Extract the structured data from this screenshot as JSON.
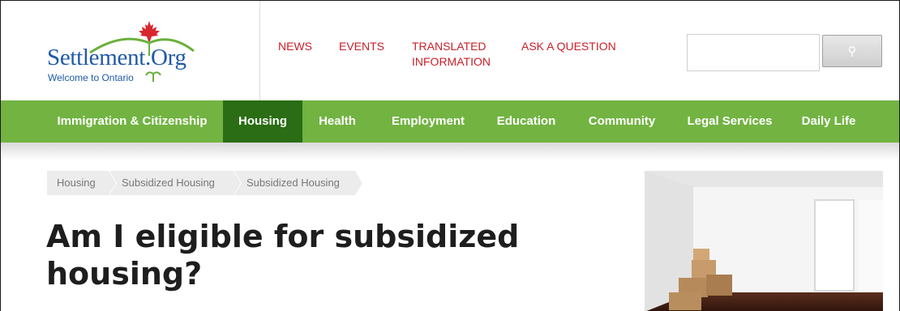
{
  "logo": {
    "name": "Settlement.Org",
    "tagline": "Welcome to Ontario"
  },
  "topnav": {
    "items": [
      "NEWS",
      "EVENTS",
      "TRANSLATED INFORMATION",
      "ASK A QUESTION"
    ]
  },
  "search": {
    "value": "",
    "button_icon": "search-icon"
  },
  "mainnav": {
    "items": [
      "Immigration & Citizenship",
      "Housing",
      "Health",
      "Employment",
      "Education",
      "Community",
      "Legal Services",
      "Daily Life"
    ],
    "active": "Housing"
  },
  "breadcrumb": [
    "Housing",
    "Subsidized Housing",
    "Subsidized Housing"
  ],
  "page": {
    "title": "Am I eligible for subsidized housing?"
  },
  "colors": {
    "nav_green": "#72b342",
    "nav_active": "#2a6d14",
    "link_red": "#c8202a",
    "logo_blue": "#1f5aa8",
    "leaf_red": "#d7262e"
  }
}
